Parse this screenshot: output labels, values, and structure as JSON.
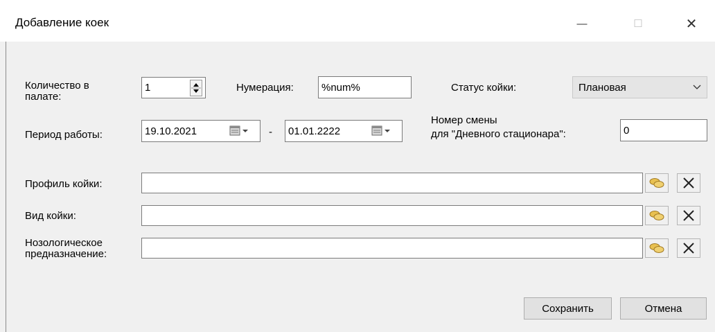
{
  "window": {
    "title": "Добавление коек",
    "minimize_glyph": "—",
    "maximize_glyph": "☐",
    "close_glyph": "✕"
  },
  "form": {
    "count_label": "Количество в палате:",
    "count_value": "1",
    "numbering_label": "Нумерация:",
    "numbering_value": "%num%",
    "status_label": "Статус койки:",
    "status_value": "Плановая",
    "period_label": "Период работы:",
    "period_from": "19.10.2021",
    "period_dash": "-",
    "period_to": "01.01.2222",
    "shift_label_line1": "Номер смены",
    "shift_label_line2": "для \"Дневного стационара\":",
    "shift_value": "0",
    "profile_label": "Профиль койки:",
    "profile_value": "",
    "type_label": "Вид койки:",
    "type_value": "",
    "nosology_label": "Нозологическое предназначение:",
    "nosology_value": ""
  },
  "buttons": {
    "save": "Сохранить",
    "cancel": "Отмена"
  },
  "icons": {
    "lookup": "lookup-icon",
    "clear": "clear-icon",
    "calendar": "calendar-icon",
    "spinner": "spinner-icon"
  }
}
